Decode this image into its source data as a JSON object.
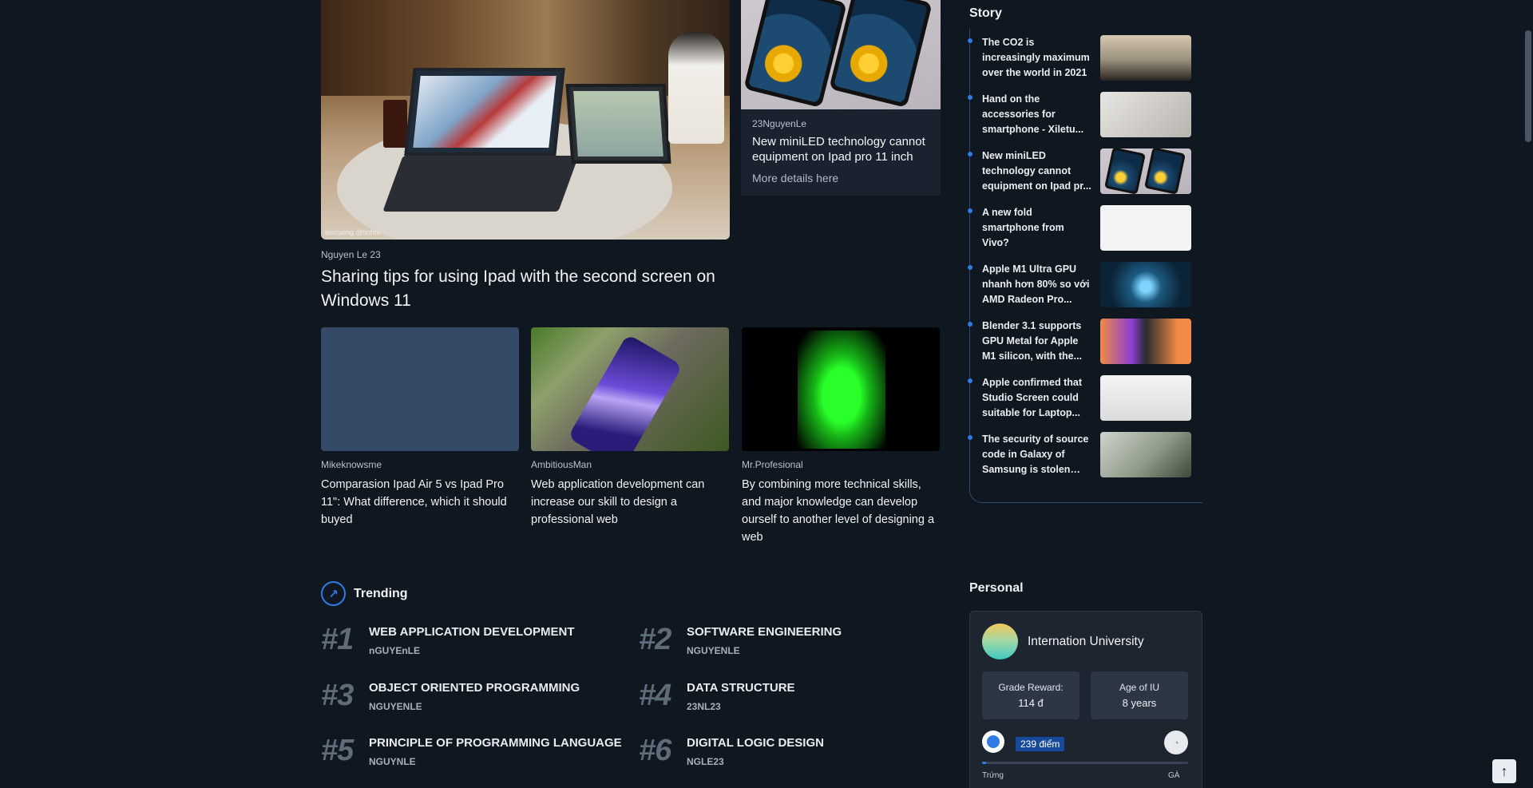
{
  "hero": {
    "watermark": "lexcuong @tinhte",
    "author": "Nguyen Le 23",
    "title": "Sharing tips for using Ipad with the second screen on Windows 11"
  },
  "hero_side": {
    "author": "23NguyenLe",
    "title": "New miniLED technology cannot equipment on Ipad pro 11 inch",
    "more": "More details here"
  },
  "cards": [
    {
      "author": "Mikeknowsme",
      "title": "Comparasion Ipad Air 5 vs Ipad Pro 11\": What difference, which it should buyed"
    },
    {
      "author": "AmbitiousMan",
      "title": "Web application development can increase our skill to design a professional web"
    },
    {
      "author": "Mr.Profesional",
      "title": "By combining more technical skills, and major knowledge can develop ourself to another level of designing a web"
    }
  ],
  "trending": {
    "title": "Trending",
    "items": [
      {
        "rank": "#1",
        "name": "WEB APPLICATION DEVELOPMENT",
        "sub": "nGUYEnLE"
      },
      {
        "rank": "#2",
        "name": "SOFTWARE ENGINEERING",
        "sub": "NGUYENLE"
      },
      {
        "rank": "#3",
        "name": "OBJECT ORIENTED PROGRAMMING",
        "sub": "NGUYENLE"
      },
      {
        "rank": "#4",
        "name": "DATA STRUCTURE",
        "sub": "23NL23"
      },
      {
        "rank": "#5",
        "name": "PRINCIPLE OF PROGRAMMING LANGUAGE",
        "sub": "NGUYNLE"
      },
      {
        "rank": "#6",
        "name": "DIGITAL LOGIC DESIGN",
        "sub": "NGLE23"
      }
    ]
  },
  "story": {
    "title": "Story",
    "items": [
      {
        "text": "The CO2 is increasingly maximum over the world in 2021"
      },
      {
        "text": "Hand on the accessories for smartphone - Xiletu..."
      },
      {
        "text": "New miniLED technology cannot equipment on Ipad pr..."
      },
      {
        "text": "A new fold smartphone from Vivo?"
      },
      {
        "text": "Apple M1 Ultra GPU nhanh hơn 80% so với AMD Radeon Pro..."
      },
      {
        "text": "Blender 3.1 supports GPU Metal for Apple M1 silicon, with the..."
      },
      {
        "text": "Apple confirmed that Studio Screen could suitable for Laptop..."
      },
      {
        "text": "The security of source code in Galaxy of Samsung is stolen by..."
      }
    ]
  },
  "personal": {
    "title": "Personal",
    "name": "Internation University",
    "grade_label": "Grade Reward:",
    "grade_value": "114 đ",
    "age_label": "Age of IU",
    "age_value": "8 years",
    "points": "239 điểm",
    "progress_fraction": 0.02,
    "level_left": "Trứng",
    "level_right": "GÀ"
  },
  "colors": {
    "background": "#0f1720",
    "accent": "#2f7be5",
    "panel": "#1d2530"
  },
  "icons": {
    "trending": "trending-up-icon",
    "back_to_top": "arrow-up-icon"
  }
}
